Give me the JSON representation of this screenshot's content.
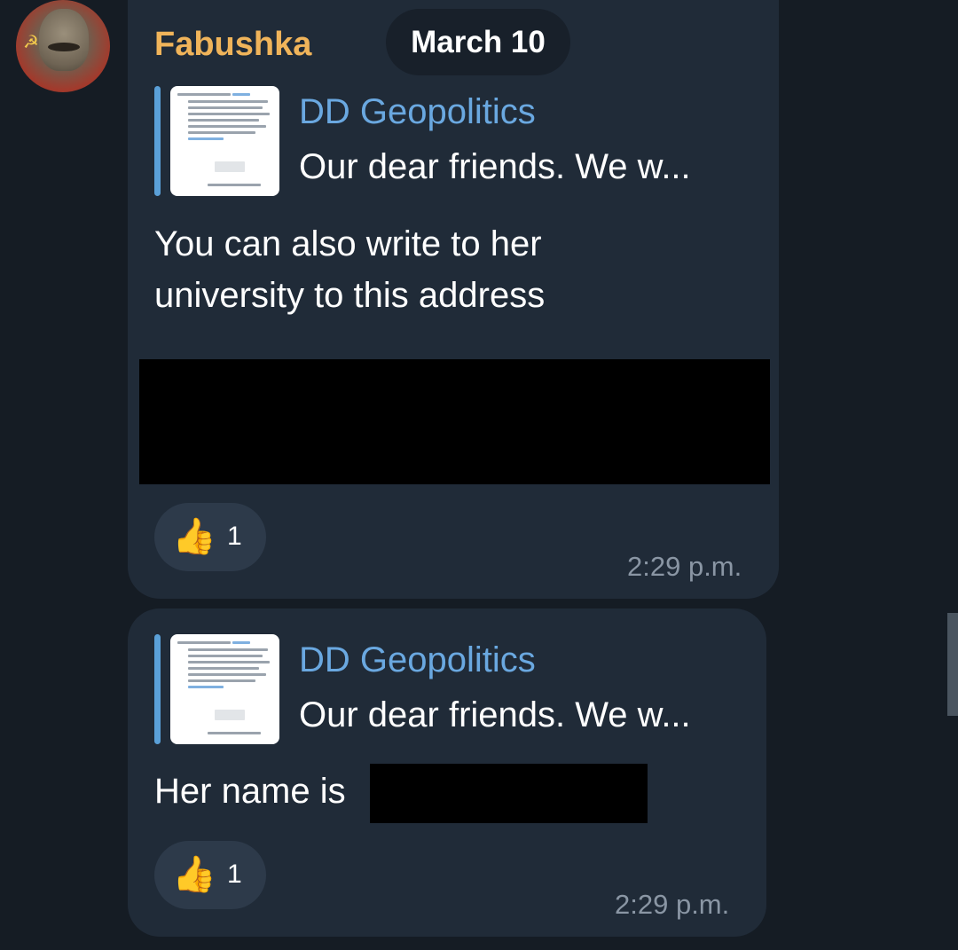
{
  "chat": {
    "sender_name": "Fabushka",
    "date_separator": "March 10",
    "colors": {
      "background": "#151c24",
      "bubble": "#202b38",
      "sender": "#f0b45a",
      "quote_accent": "#5aa0d8",
      "timestamp": "#8a96a4"
    },
    "messages": [
      {
        "reply_quote": {
          "title": "DD Geopolitics",
          "preview": "Our dear friends. We w..."
        },
        "text": "You can also write to her university to this address",
        "redacted": true,
        "reaction": {
          "emoji": "👍",
          "emoji_icon": "thumbs-up-icon",
          "count": "1"
        },
        "time": "2:29 p.m."
      },
      {
        "reply_quote": {
          "title": "DD Geopolitics",
          "preview": "Our dear friends. We w..."
        },
        "text": "Her name is",
        "redacted": true,
        "reaction": {
          "emoji": "👍",
          "emoji_icon": "thumbs-up-icon",
          "count": "1"
        },
        "time": "2:29 p.m."
      }
    ]
  }
}
